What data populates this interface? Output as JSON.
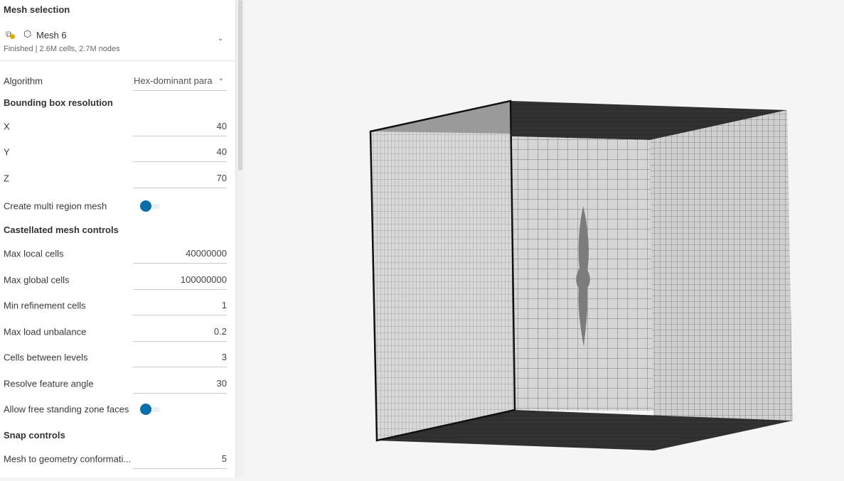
{
  "panel": {
    "mesh_selection_title": "Mesh selection",
    "mesh": {
      "name": "Mesh 6",
      "status": "Finished | 2.6M cells, 2.7M nodes"
    },
    "algorithm": {
      "label": "Algorithm",
      "value": "Hex-dominant para"
    },
    "bbox_title": "Bounding box resolution",
    "bbox": [
      {
        "label": "X",
        "value": "40"
      },
      {
        "label": "Y",
        "value": "40"
      },
      {
        "label": "Z",
        "value": "70"
      }
    ],
    "multi_region": {
      "label": "Create multi region mesh",
      "on": true
    },
    "castellated_title": "Castellated mesh controls",
    "castellated": [
      {
        "label": "Max local cells",
        "value": "40000000"
      },
      {
        "label": "Max global cells",
        "value": "100000000"
      },
      {
        "label": "Min refinement cells",
        "value": "1"
      },
      {
        "label": "Max load unbalance",
        "value": "0.2"
      },
      {
        "label": "Cells between levels",
        "value": "3"
      },
      {
        "label": "Resolve feature angle",
        "value": "30"
      }
    ],
    "free_standing": {
      "label": "Allow free standing zone faces",
      "on": true
    },
    "snap_title": "Snap controls",
    "snap": [
      {
        "label": "Mesh to geometry conformati...",
        "value": "5"
      }
    ]
  },
  "colors": {
    "accent": "#0a6fa8"
  }
}
